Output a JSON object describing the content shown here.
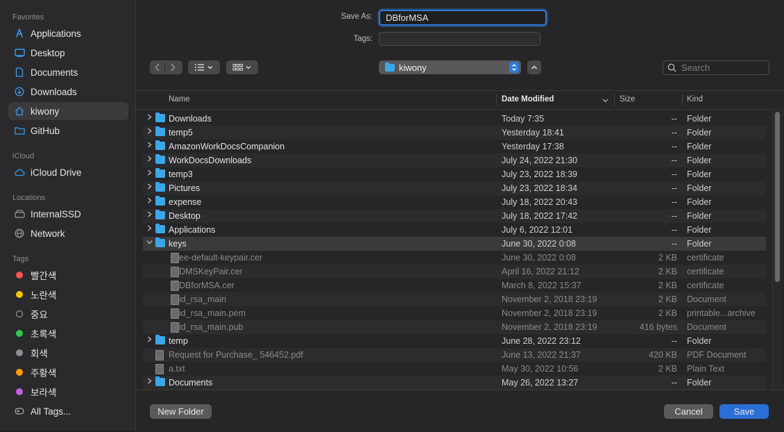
{
  "sidebar": {
    "favorites_title": "Favorites",
    "favorites": [
      {
        "label": "Applications",
        "icon": "applications-icon"
      },
      {
        "label": "Desktop",
        "icon": "desktop-icon"
      },
      {
        "label": "Documents",
        "icon": "document-icon"
      },
      {
        "label": "Downloads",
        "icon": "downloads-icon"
      },
      {
        "label": "kiwony",
        "icon": "home-icon",
        "selected": true
      },
      {
        "label": "GitHub",
        "icon": "folder-icon"
      }
    ],
    "icloud_title": "iCloud",
    "icloud": [
      {
        "label": "iCloud Drive",
        "icon": "cloud-icon"
      }
    ],
    "locations_title": "Locations",
    "locations": [
      {
        "label": "InternalSSD",
        "icon": "disk-icon"
      },
      {
        "label": "Network",
        "icon": "globe-icon"
      }
    ],
    "tags_title": "Tags",
    "tags": [
      {
        "label": "빨간색",
        "color": "#ff5257"
      },
      {
        "label": "노란색",
        "color": "#f5c400"
      },
      {
        "label": "중요",
        "color": "none"
      },
      {
        "label": "초록색",
        "color": "#2ec94a"
      },
      {
        "label": "회색",
        "color": "#8e8e93"
      },
      {
        "label": "주황색",
        "color": "#ff9d0a"
      },
      {
        "label": "보라색",
        "color": "#c55ee0"
      }
    ],
    "all_tags": "All Tags..."
  },
  "form": {
    "save_as_label": "Save As:",
    "save_as_value": "DBforMSA",
    "tags_label": "Tags:"
  },
  "toolbar": {
    "location": "kiwony",
    "search_placeholder": "Search"
  },
  "columns": {
    "name": "Name",
    "date": "Date Modified",
    "size": "Size",
    "kind": "Kind"
  },
  "rows": [
    {
      "name": "Downloads",
      "date": "Today 7:35",
      "size": "--",
      "kind": "Folder",
      "type": "folder",
      "expander": "closed",
      "indent": 0,
      "dim": false
    },
    {
      "name": "temp5",
      "date": "Yesterday 18:41",
      "size": "--",
      "kind": "Folder",
      "type": "folder",
      "expander": "closed",
      "indent": 0,
      "dim": false
    },
    {
      "name": "AmazonWorkDocsCompanion",
      "date": "Yesterday 17:38",
      "size": "--",
      "kind": "Folder",
      "type": "folder",
      "expander": "closed",
      "indent": 0,
      "dim": false
    },
    {
      "name": "WorkDocsDownloads",
      "date": "July 24, 2022 21:30",
      "size": "--",
      "kind": "Folder",
      "type": "folder",
      "expander": "closed",
      "indent": 0,
      "dim": false
    },
    {
      "name": "temp3",
      "date": "July 23, 2022 18:39",
      "size": "--",
      "kind": "Folder",
      "type": "folder",
      "expander": "closed",
      "indent": 0,
      "dim": false
    },
    {
      "name": "Pictures",
      "date": "July 23, 2022 18:34",
      "size": "--",
      "kind": "Folder",
      "type": "folder",
      "expander": "closed",
      "indent": 0,
      "dim": false
    },
    {
      "name": "expense",
      "date": "July 18, 2022 20:43",
      "size": "--",
      "kind": "Folder",
      "type": "folder",
      "expander": "closed",
      "indent": 0,
      "dim": false
    },
    {
      "name": "Desktop",
      "date": "July 18, 2022 17:42",
      "size": "--",
      "kind": "Folder",
      "type": "folder",
      "expander": "closed",
      "indent": 0,
      "dim": false
    },
    {
      "name": "Applications",
      "date": "July 6, 2022 12:01",
      "size": "--",
      "kind": "Folder",
      "type": "folder",
      "expander": "closed",
      "indent": 0,
      "dim": false
    },
    {
      "name": "keys",
      "date": "June 30, 2022 0:08",
      "size": "--",
      "kind": "Folder",
      "type": "folder",
      "expander": "open",
      "indent": 0,
      "dim": false,
      "selected": true
    },
    {
      "name": "ee-default-keypair.cer",
      "date": "June 30, 2022 0:08",
      "size": "2 KB",
      "kind": "certificate",
      "type": "file",
      "expander": "none",
      "indent": 1,
      "dim": true
    },
    {
      "name": "DMSKeyPair.cer",
      "date": "April 16, 2022 21:12",
      "size": "2 KB",
      "kind": "certificate",
      "type": "file",
      "expander": "none",
      "indent": 1,
      "dim": true
    },
    {
      "name": "DBforMSA.cer",
      "date": "March 8, 2022 15:37",
      "size": "2 KB",
      "kind": "certificate",
      "type": "file",
      "expander": "none",
      "indent": 1,
      "dim": true
    },
    {
      "name": "id_rsa_main",
      "date": "November 2, 2018 23:19",
      "size": "2 KB",
      "kind": "Document",
      "type": "file",
      "expander": "none",
      "indent": 1,
      "dim": true
    },
    {
      "name": "id_rsa_main.pem",
      "date": "November 2, 2018 23:19",
      "size": "2 KB",
      "kind": "printable...archive",
      "type": "file",
      "expander": "none",
      "indent": 1,
      "dim": true
    },
    {
      "name": "id_rsa_main.pub",
      "date": "November 2, 2018 23:19",
      "size": "416 bytes",
      "kind": "Document",
      "type": "file",
      "expander": "none",
      "indent": 1,
      "dim": true
    },
    {
      "name": "temp",
      "date": "June 28, 2022 23:12",
      "size": "--",
      "kind": "Folder",
      "type": "folder",
      "expander": "closed",
      "indent": 0,
      "dim": false
    },
    {
      "name": "Request for Purchase_ 546452.pdf",
      "date": "June 13, 2022 21:37",
      "size": "420 KB",
      "kind": "PDF Document",
      "type": "file",
      "expander": "none",
      "indent": 0,
      "dim": true
    },
    {
      "name": "a.txt",
      "date": "May 30, 2022 10:56",
      "size": "2 KB",
      "kind": "Plain Text",
      "type": "file",
      "expander": "none",
      "indent": 0,
      "dim": true
    },
    {
      "name": "Documents",
      "date": "May 26, 2022 13:27",
      "size": "--",
      "kind": "Folder",
      "type": "folder",
      "expander": "closed",
      "indent": 0,
      "dim": false
    }
  ],
  "buttons": {
    "new_folder": "New Folder",
    "cancel": "Cancel",
    "save": "Save"
  }
}
